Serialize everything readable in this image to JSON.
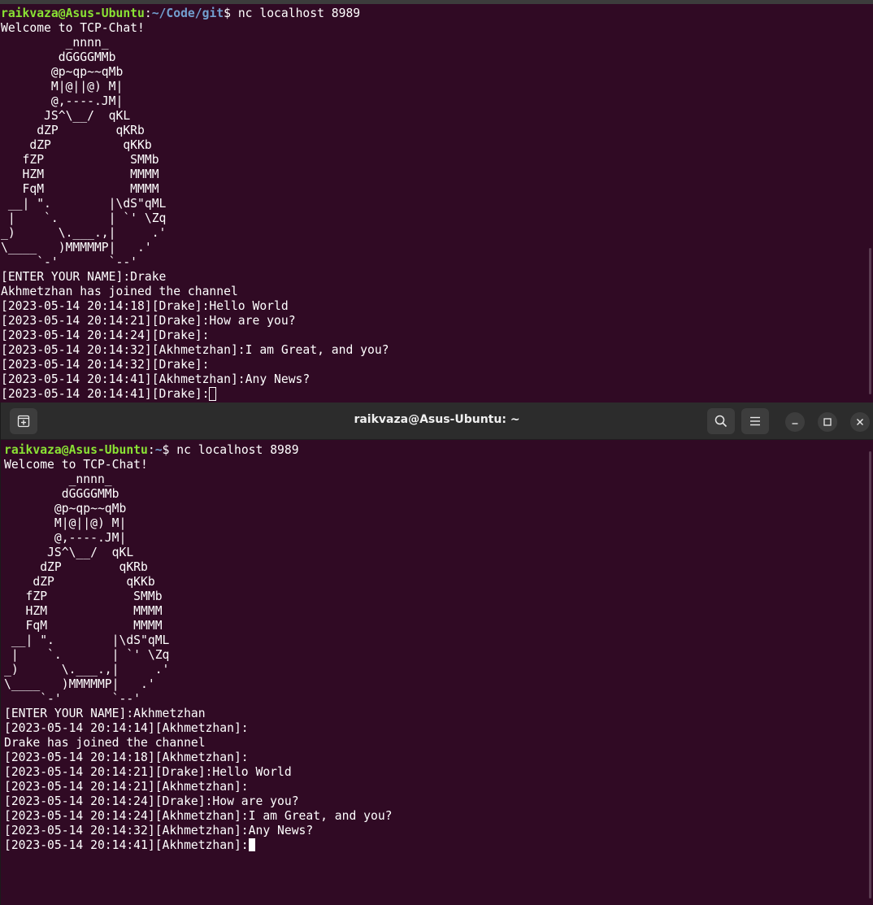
{
  "top_terminal": {
    "prompt_user": "raikvaza@Asus-Ubuntu",
    "prompt_colon": ":",
    "prompt_path": "~/Code/git",
    "prompt_dollar": "$ ",
    "command": "nc localhost 8989",
    "lines": [
      "Welcome to TCP-Chat!",
      "         _nnnn_",
      "        dGGGGMMb",
      "       @p~qp~~qMb",
      "       M|@||@) M|",
      "       @,----.JM|",
      "      JS^\\__/  qKL",
      "     dZP        qKRb",
      "    dZP          qKKb",
      "   fZP            SMMb",
      "   HZM            MMMM",
      "   FqM            MMMM",
      " __| \".        |\\dS\"qML",
      " |    `.       | `' \\Zq",
      "_)      \\.___.,|     .'",
      "\\____   )MMMMMP|   .'",
      "     `-'       `--'",
      "[ENTER YOUR NAME]:Drake",
      "Akhmetzhan has joined the channel",
      "[2023-05-14 20:14:18][Drake]:Hello World",
      "[2023-05-14 20:14:21][Drake]:How are you?",
      "[2023-05-14 20:14:24][Drake]:",
      "[2023-05-14 20:14:32][Akhmetzhan]:I am Great, and you?",
      "[2023-05-14 20:14:32][Drake]:",
      "[2023-05-14 20:14:41][Akhmetzhan]:Any News?"
    ],
    "current_input_line": "[2023-05-14 20:14:41][Drake]:"
  },
  "bottom_terminal": {
    "title": "raikvaza@Asus-Ubuntu: ~",
    "new_tab_icon": "new-tab-icon",
    "search_icon": "search-icon",
    "menu_icon": "hamburger-menu-icon",
    "minimize_icon": "minimize-icon",
    "maximize_icon": "maximize-icon",
    "close_icon": "close-icon",
    "prompt_user": "raikvaza@Asus-Ubuntu",
    "prompt_colon": ":",
    "prompt_path": "~",
    "prompt_dollar": "$ ",
    "command": "nc localhost 8989",
    "lines": [
      "Welcome to TCP-Chat!",
      "         _nnnn_",
      "        dGGGGMMb",
      "       @p~qp~~qMb",
      "       M|@||@) M|",
      "       @,----.JM|",
      "      JS^\\__/  qKL",
      "     dZP        qKRb",
      "    dZP          qKKb",
      "   fZP            SMMb",
      "   HZM            MMMM",
      "   FqM            MMMM",
      " __| \".        |\\dS\"qML",
      " |    `.       | `' \\Zq",
      "_)      \\.___.,|     .'",
      "\\____   )MMMMMP|   .'",
      "     `-'       `--'",
      "[ENTER YOUR NAME]:Akhmetzhan",
      "[2023-05-14 20:14:14][Akhmetzhan]:",
      "Drake has joined the channel",
      "[2023-05-14 20:14:18][Akhmetzhan]:",
      "[2023-05-14 20:14:21][Drake]:Hello World",
      "[2023-05-14 20:14:21][Akhmetzhan]:",
      "[2023-05-14 20:14:24][Drake]:How are you?",
      "[2023-05-14 20:14:24][Akhmetzhan]:I am Great, and you?",
      "[2023-05-14 20:14:32][Akhmetzhan]:Any News?"
    ],
    "current_input_line": "[2023-05-14 20:14:41][Akhmetzhan]:"
  }
}
